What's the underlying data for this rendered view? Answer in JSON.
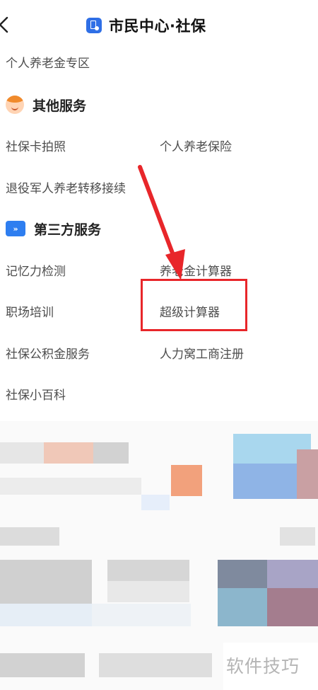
{
  "header": {
    "back_icon": "chevron-left-icon",
    "title_icon": "doc-badge-icon",
    "title": "市民中心·社保"
  },
  "sections": {
    "top_link": "个人养老金专区",
    "other": {
      "icon": "face-icon",
      "title": "其他服务",
      "items": [
        "社保卡拍照",
        "个人养老保险",
        "退役军人养老转移接续"
      ]
    },
    "third_party": {
      "icon": "third-party-icon",
      "icon_glyph": "»",
      "title": "第三方服务",
      "items": [
        "记忆力检测",
        "养老金计算器",
        "职场培训",
        "超级计算器",
        "社保公积金服务",
        "人力窝工商注册",
        "社保小百科"
      ]
    }
  },
  "annotation": {
    "highlight_color": "#e8262a",
    "highlighted_item": "超级计算器"
  },
  "watermark": "软件技巧"
}
